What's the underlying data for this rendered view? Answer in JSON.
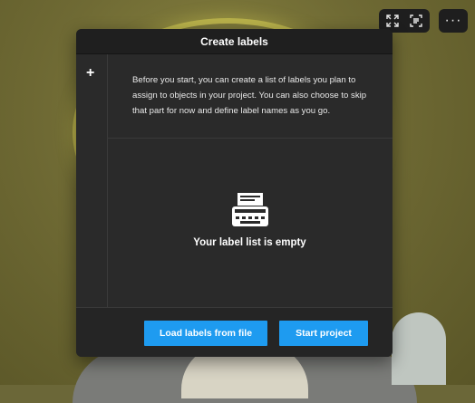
{
  "dialog": {
    "title": "Create labels",
    "add_icon": "plus-icon",
    "description": "Before you start, you can create a list of labels you plan to assign to objects in your project. You can also choose to skip that part for now and define label names as you go.",
    "empty_icon": "typewriter-icon",
    "empty_text": "Your label list is empty",
    "load_button_label": "Load labels from file",
    "start_button_label": "Start project",
    "accent_color": "#1e9bf0"
  },
  "toolbar": {
    "icons": [
      "expand-icon",
      "scan-icon",
      "more-icon"
    ],
    "more_label": "···"
  }
}
